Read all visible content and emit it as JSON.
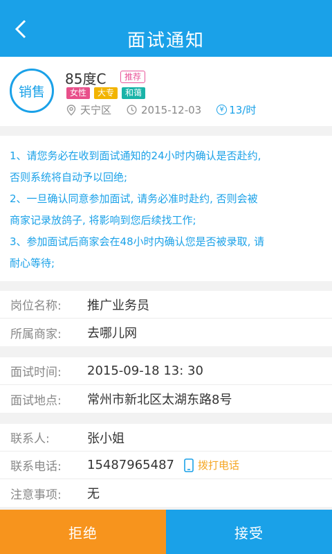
{
  "header": {
    "title": "面试通知"
  },
  "job": {
    "category_badge": "销售",
    "brand_name": "85度C",
    "recommend_label": "推荐",
    "tags": [
      {
        "label": "女性",
        "color": "#e84f8a"
      },
      {
        "label": "大专",
        "color": "#f2b400"
      },
      {
        "label": "和蔼",
        "color": "#19b3a8"
      }
    ],
    "district": "天宁区",
    "date": "2015-12-03",
    "wage": "13/时",
    "currency_symbol": "¥"
  },
  "notice": {
    "lines": [
      "1、请您务必在收到面试通知的24小时内确认是否赴约,",
      "否则系统将自动予以回绝;",
      "2、一旦确认同意参加面试, 请务必准时赴约, 否则会被",
      "商家记录放鸽子, 将影响到您后续找工作;",
      "3、参加面试后商家会在48小时内确认您是否被录取, 请",
      "耐心等待;"
    ]
  },
  "position": {
    "name_label": "岗位名称:",
    "name_value": "推广业务员",
    "merchant_label": "所属商家:",
    "merchant_value": "去哪儿网"
  },
  "interview": {
    "time_label": "面试时间:",
    "time_value": "2015-09-18 13: 30",
    "place_label": "面试地点:",
    "place_value": "常州市新北区太湖东路8号"
  },
  "contact": {
    "person_label": "联系人:",
    "person_value": "张小姐",
    "phone_label": "联系电话:",
    "phone_value": "15487965487",
    "call_label": "拨打电话",
    "notes_label": "注意事项:",
    "notes_value": "无"
  },
  "footer": {
    "reject_label": "拒绝",
    "accept_label": "接受"
  },
  "colors": {
    "primary": "#1aa1e8",
    "accent": "#f7941d",
    "call": "#f5a623"
  },
  "icons": {
    "back": "chevron-left-icon",
    "location": "location-pin-icon",
    "clock": "clock-icon",
    "yen": "yen-icon",
    "phone": "phone-icon"
  }
}
